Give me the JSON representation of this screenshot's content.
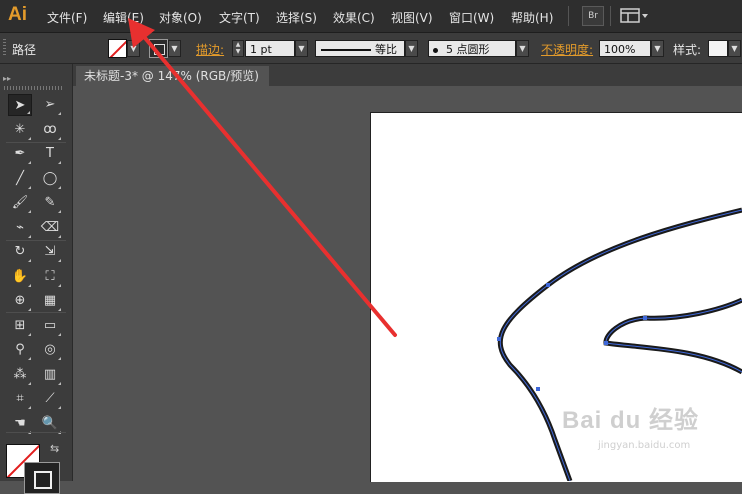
{
  "app": {
    "logo": "Ai",
    "accent_color": "#e39b2b",
    "annotation_color": "#e8302f"
  },
  "menu": {
    "items": [
      "文件(F)",
      "编辑(E)",
      "对象(O)",
      "文字(T)",
      "选择(S)",
      "效果(C)",
      "视图(V)",
      "窗口(W)",
      "帮助(H)"
    ],
    "bridge_button": "Br",
    "workspace_icon": "layout-grid-icon"
  },
  "control_bar": {
    "selection_label": "路径",
    "stroke_label": "描边:",
    "stroke_weight": "1 pt",
    "stroke_profile": "等比",
    "brush": "5 点圆形",
    "opacity_label": "不透明度:",
    "opacity_value": "100%",
    "style_label": "样式:"
  },
  "document_tab": {
    "title": "未标题-3* @ 147% (RGB/预览)"
  },
  "tools": [
    "selection-tool-icon",
    "direct-selection-tool-icon",
    "magic-wand-tool-icon",
    "lasso-tool-icon",
    "pen-tool-icon",
    "type-tool-icon",
    "line-segment-tool-icon",
    "ellipse-tool-icon",
    "paintbrush-tool-icon",
    "pencil-tool-icon",
    "blob-brush-tool-icon",
    "eraser-tool-icon",
    "rotate-tool-icon",
    "scale-tool-icon",
    "warp-tool-icon",
    "free-transform-tool-icon",
    "shape-builder-tool-icon",
    "perspective-grid-tool-icon",
    "mesh-tool-icon",
    "gradient-tool-icon",
    "eyedropper-tool-icon",
    "blend-tool-icon",
    "symbol-sprayer-tool-icon",
    "column-graph-tool-icon",
    "artboard-tool-icon",
    "slice-tool-icon",
    "hand-tool-icon",
    "zoom-tool-icon"
  ],
  "watermark": {
    "text": "Bai du 经验",
    "url_text": "jingyan.baidu.com"
  }
}
